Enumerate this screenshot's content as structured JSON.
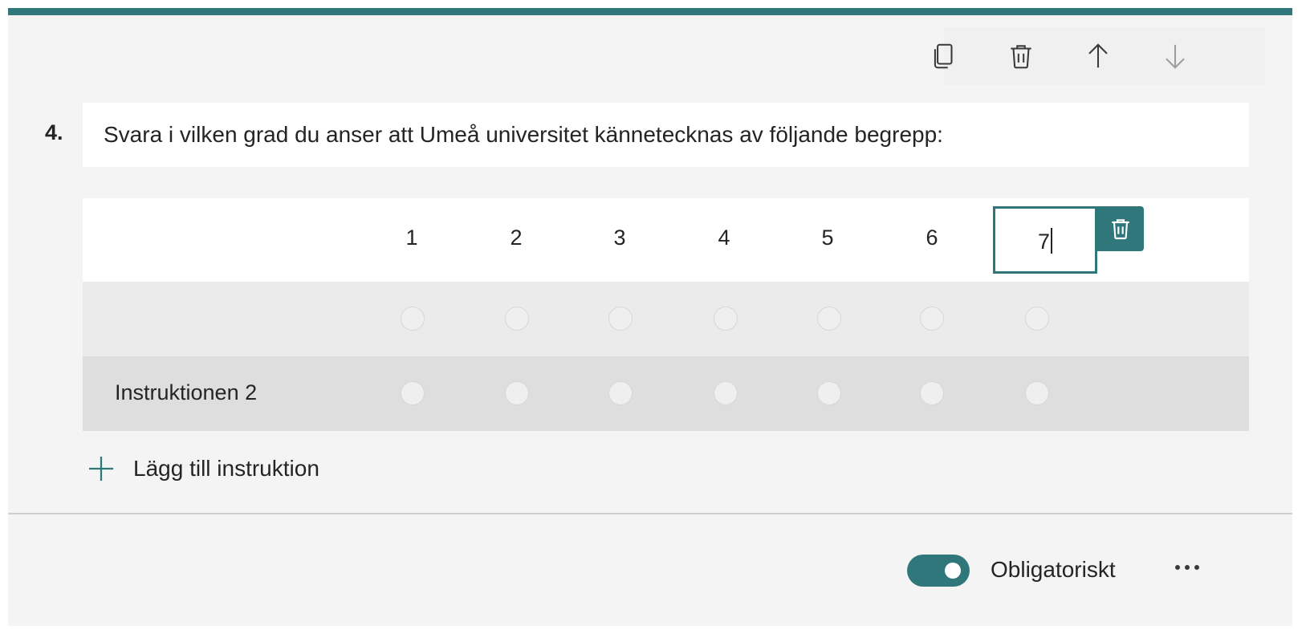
{
  "question": {
    "number": "4.",
    "title": "Svara i vilken grad du anser att Umeå universitet kännetecknas av följande begrepp:"
  },
  "toolbar": {
    "icons": [
      "copy-icon",
      "trash-icon",
      "arrow-up-icon",
      "arrow-down-icon"
    ]
  },
  "likert": {
    "columns": [
      "1",
      "2",
      "3",
      "4",
      "5",
      "6"
    ],
    "editing_column_value": "7",
    "rows": [
      {
        "label": ""
      },
      {
        "label": "Instruktionen 2"
      }
    ]
  },
  "add_statement_label": "Lägg till instruktion",
  "footer": {
    "required_label": "Obligatoriskt",
    "required_on": true
  },
  "colors": {
    "accent": "#30777b",
    "card_bg": "#f4f4f4"
  }
}
